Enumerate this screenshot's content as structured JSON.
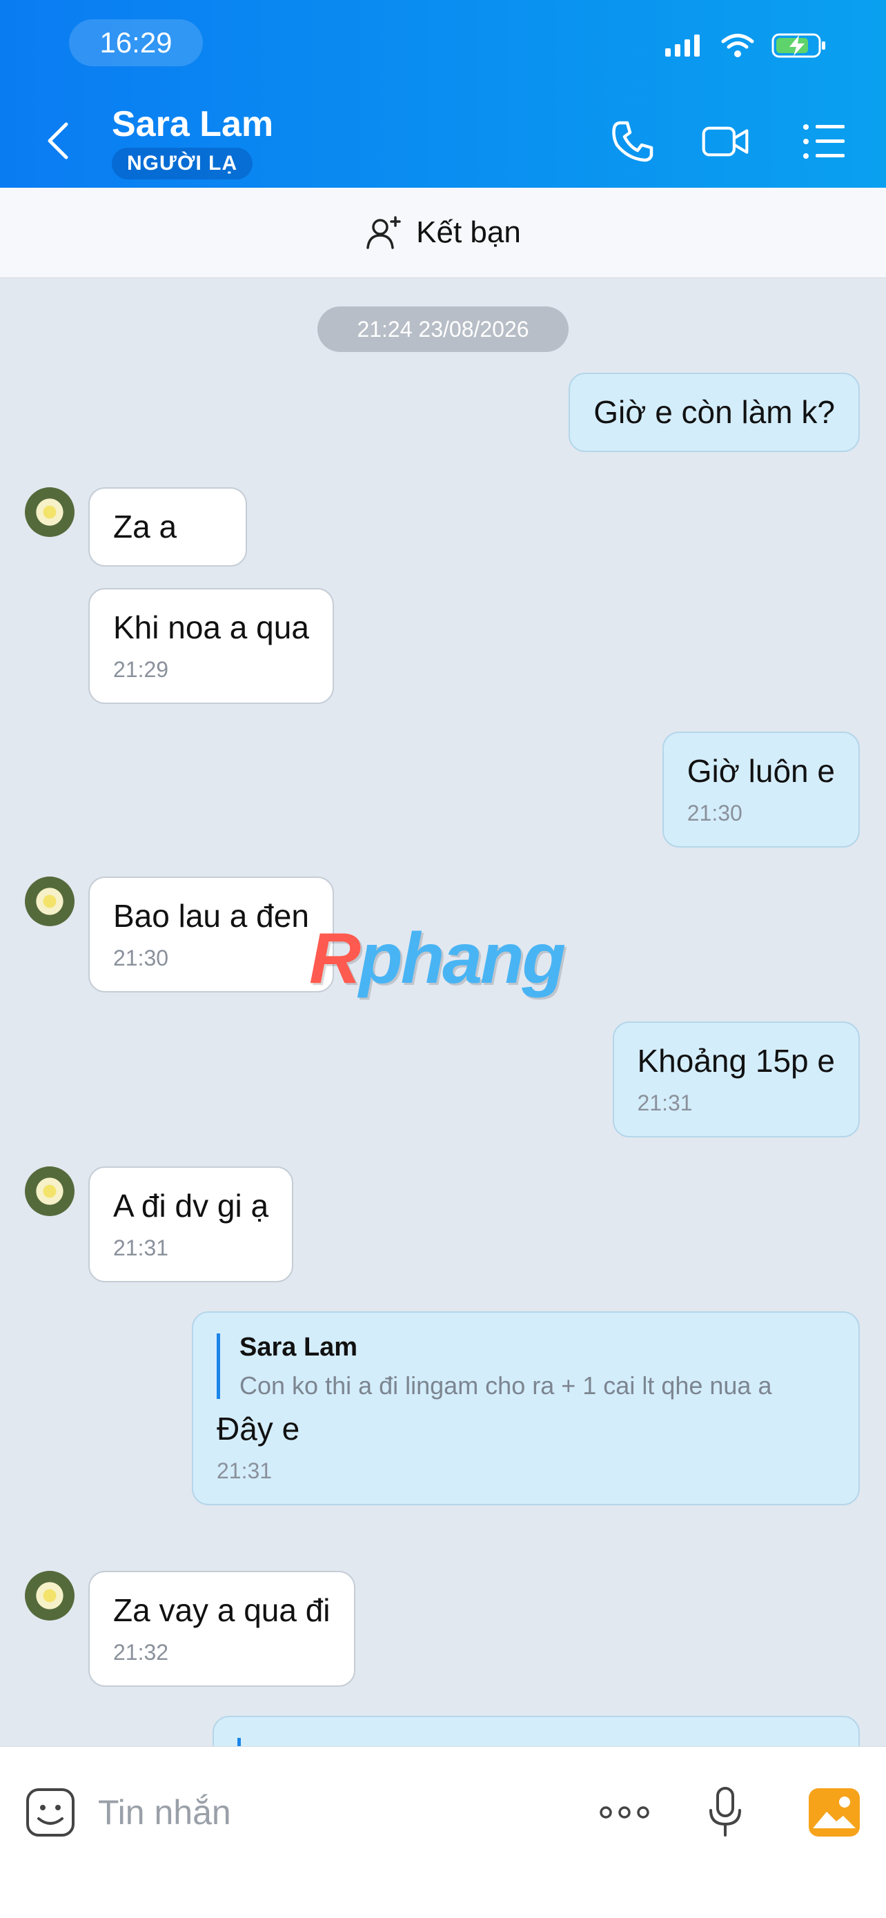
{
  "status_bar": {
    "time": "16:29"
  },
  "header": {
    "contact_name": "Sara Lam",
    "stranger_badge": "NGƯỜI LẠ"
  },
  "friend_bar": {
    "label": "Kết bạn"
  },
  "chat": {
    "date_separator": "21:24 23/08/2026",
    "messages": [
      {
        "sender": "me",
        "text": "Giờ e còn làm k?"
      },
      {
        "sender": "them",
        "text": "Za a"
      },
      {
        "sender": "them",
        "text": "Khi noa a qua",
        "time": "21:29"
      },
      {
        "sender": "me",
        "text": "Giờ luôn e",
        "time": "21:30"
      },
      {
        "sender": "them",
        "text": "Bao lau a đen",
        "time": "21:30"
      },
      {
        "sender": "me",
        "text": "Khoảng 15p e",
        "time": "21:31"
      },
      {
        "sender": "them",
        "text": "A đi dv gi ạ",
        "time": "21:31"
      },
      {
        "sender": "me",
        "quote_name": "Sara Lam",
        "quote_text": "Con ko thi a đi lingam cho ra + 1 cai lt qhe nua a",
        "text": "Đây e",
        "time": "21:31"
      },
      {
        "sender": "them",
        "text": "Za vay a qua đi",
        "time": "21:32"
      }
    ]
  },
  "watermark": {
    "text_first": "R",
    "text_rest": "phang"
  },
  "input": {
    "placeholder": "Tin nhắn"
  },
  "colors": {
    "header_start": "#0a7cf2",
    "header_end": "#0aa0f0",
    "bubble_out": "#d4edfb",
    "bubble_in": "#ffffff",
    "chat_bg": "#e2e8f0"
  }
}
